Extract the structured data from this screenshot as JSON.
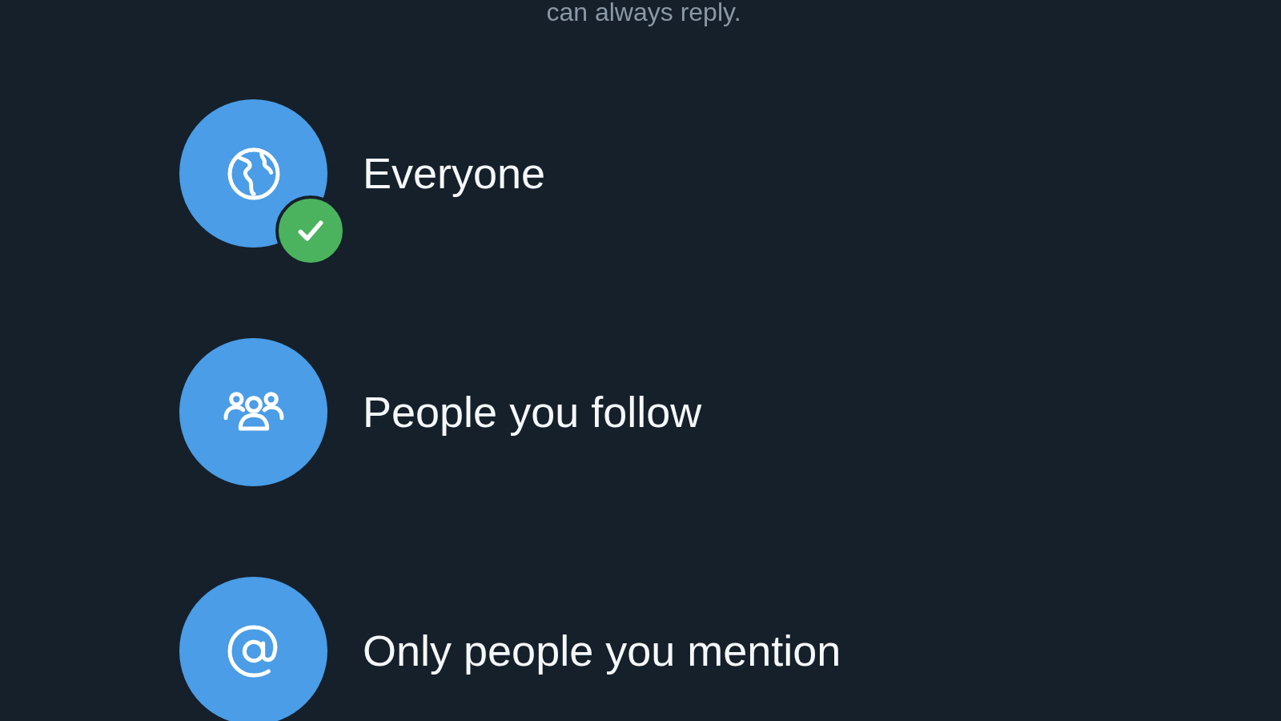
{
  "note": "can always reply.",
  "options": [
    {
      "kind": "globe",
      "label": "Everyone",
      "selected": true
    },
    {
      "kind": "people",
      "label": "People you follow",
      "selected": false
    },
    {
      "kind": "at",
      "label": "Only people you mention",
      "selected": false
    }
  ]
}
